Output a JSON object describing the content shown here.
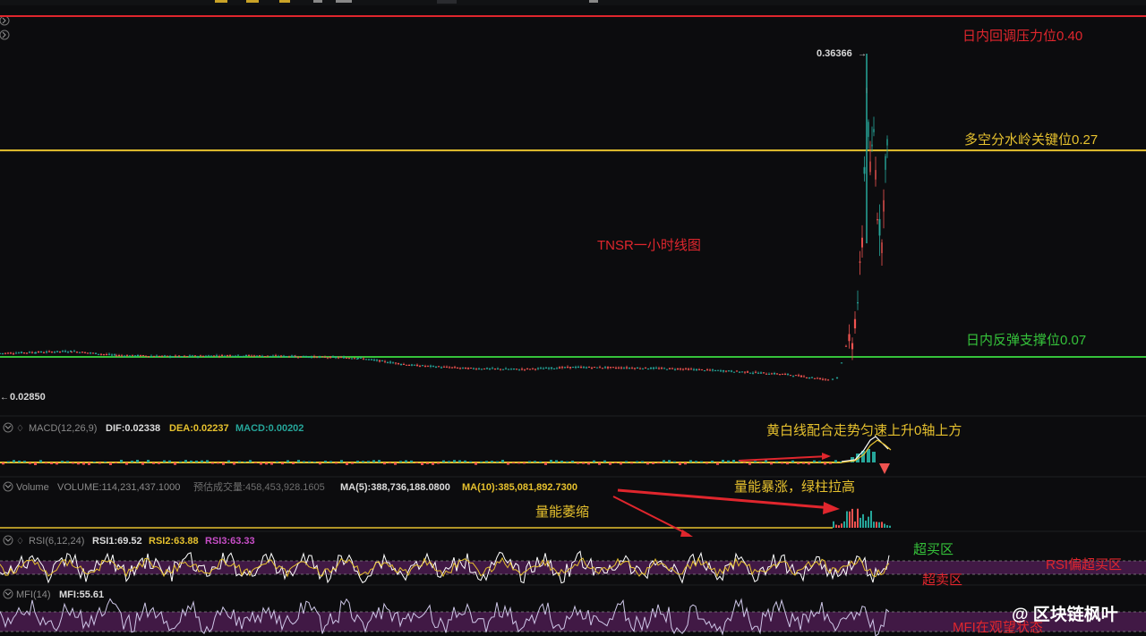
{
  "chart_data": {
    "type": "candlestick",
    "title": "TNSR一小时线图",
    "price": {
      "high_marker": "0.36366",
      "low_marker": "0.02850",
      "ylim": [
        0.0,
        0.44
      ],
      "series": [
        {
          "x": 0,
          "o": 0.0725,
          "c": 0.0735
        },
        {
          "x": 40,
          "o": 0.0735,
          "c": 0.0745
        },
        {
          "x": 80,
          "o": 0.0745,
          "c": 0.0755
        },
        {
          "x": 130,
          "o": 0.0755,
          "c": 0.0715
        },
        {
          "x": 200,
          "o": 0.0715,
          "c": 0.0705
        },
        {
          "x": 260,
          "o": 0.0705,
          "c": 0.0715
        },
        {
          "x": 330,
          "o": 0.0715,
          "c": 0.0705
        },
        {
          "x": 400,
          "o": 0.0705,
          "c": 0.069
        },
        {
          "x": 460,
          "o": 0.069,
          "c": 0.062
        },
        {
          "x": 520,
          "o": 0.062,
          "c": 0.059
        },
        {
          "x": 580,
          "o": 0.059,
          "c": 0.058
        },
        {
          "x": 640,
          "o": 0.058,
          "c": 0.06
        },
        {
          "x": 700,
          "o": 0.06,
          "c": 0.0595
        },
        {
          "x": 760,
          "o": 0.0595,
          "c": 0.0585
        },
        {
          "x": 820,
          "o": 0.0585,
          "c": 0.056
        },
        {
          "x": 880,
          "o": 0.056,
          "c": 0.053
        },
        {
          "x": 925,
          "o": 0.053,
          "c": 0.048
        },
        {
          "x": 935,
          "o": 0.048,
          "c": 0.05
        },
        {
          "x": 945,
          "o": 0.05,
          "c": 0.08
        },
        {
          "x": 952,
          "o": 0.08,
          "c": 0.085
        },
        {
          "x": 958,
          "o": 0.085,
          "c": 0.125
        },
        {
          "x": 963,
          "o": 0.125,
          "c": 0.18
        },
        {
          "x": 968,
          "o": 0.18,
          "c": 0.33
        },
        {
          "x": 972,
          "o": 0.33,
          "c": 0.25
        },
        {
          "x": 976,
          "o": 0.25,
          "c": 0.29
        },
        {
          "x": 980,
          "o": 0.29,
          "c": 0.21
        },
        {
          "x": 985,
          "o": 0.21,
          "c": 0.18
        },
        {
          "x": 989,
          "o": 0.18,
          "c": 0.26
        },
        {
          "x": 993,
          "o": 0.26,
          "c": 0.285
        }
      ],
      "peak_high": 0.36366
    },
    "levels": [
      {
        "label": "日内回调压力位0.40",
        "value": 0.4,
        "color": "#e0262d"
      },
      {
        "label": "多空分水岭关键位0.27",
        "value": 0.27,
        "color": "#e6c12e"
      },
      {
        "label": "日内反弹支撑位0.07",
        "value": 0.07,
        "color": "#35c23a"
      }
    ],
    "indicators": {
      "macd": {
        "name": "MACD(12,26,9)",
        "dif": "DIF:0.02338",
        "dea": "DEA:0.02237",
        "macd": "MACD:0.00202",
        "note": "黄白线配合走势匀速上升0轴上方"
      },
      "volume": {
        "name": "Volume",
        "volume": "VOLUME:114,231,437.1000",
        "est": "预估成交量:458,453,928.1605",
        "ma5": "MA(5):388,736,188.0800",
        "ma10": "MA(10):385,081,892.7300",
        "note_shrink": "量能萎缩",
        "note_surge": "量能暴涨，绿柱拉高"
      },
      "rsi": {
        "name": "RSI(6,12,24)",
        "rsi1": "RSI1:69.52",
        "rsi2": "RSI2:63.88",
        "rsi3": "RSI3:63.33",
        "overbought": "超买区",
        "oversold": "超卖区",
        "note": "RSI偏超买区"
      },
      "mfi": {
        "name": "MFI(14)",
        "mfi": "MFI:55.61",
        "note": "MFI在观望状态"
      }
    },
    "watermark": "@ 区块链枫叶"
  }
}
